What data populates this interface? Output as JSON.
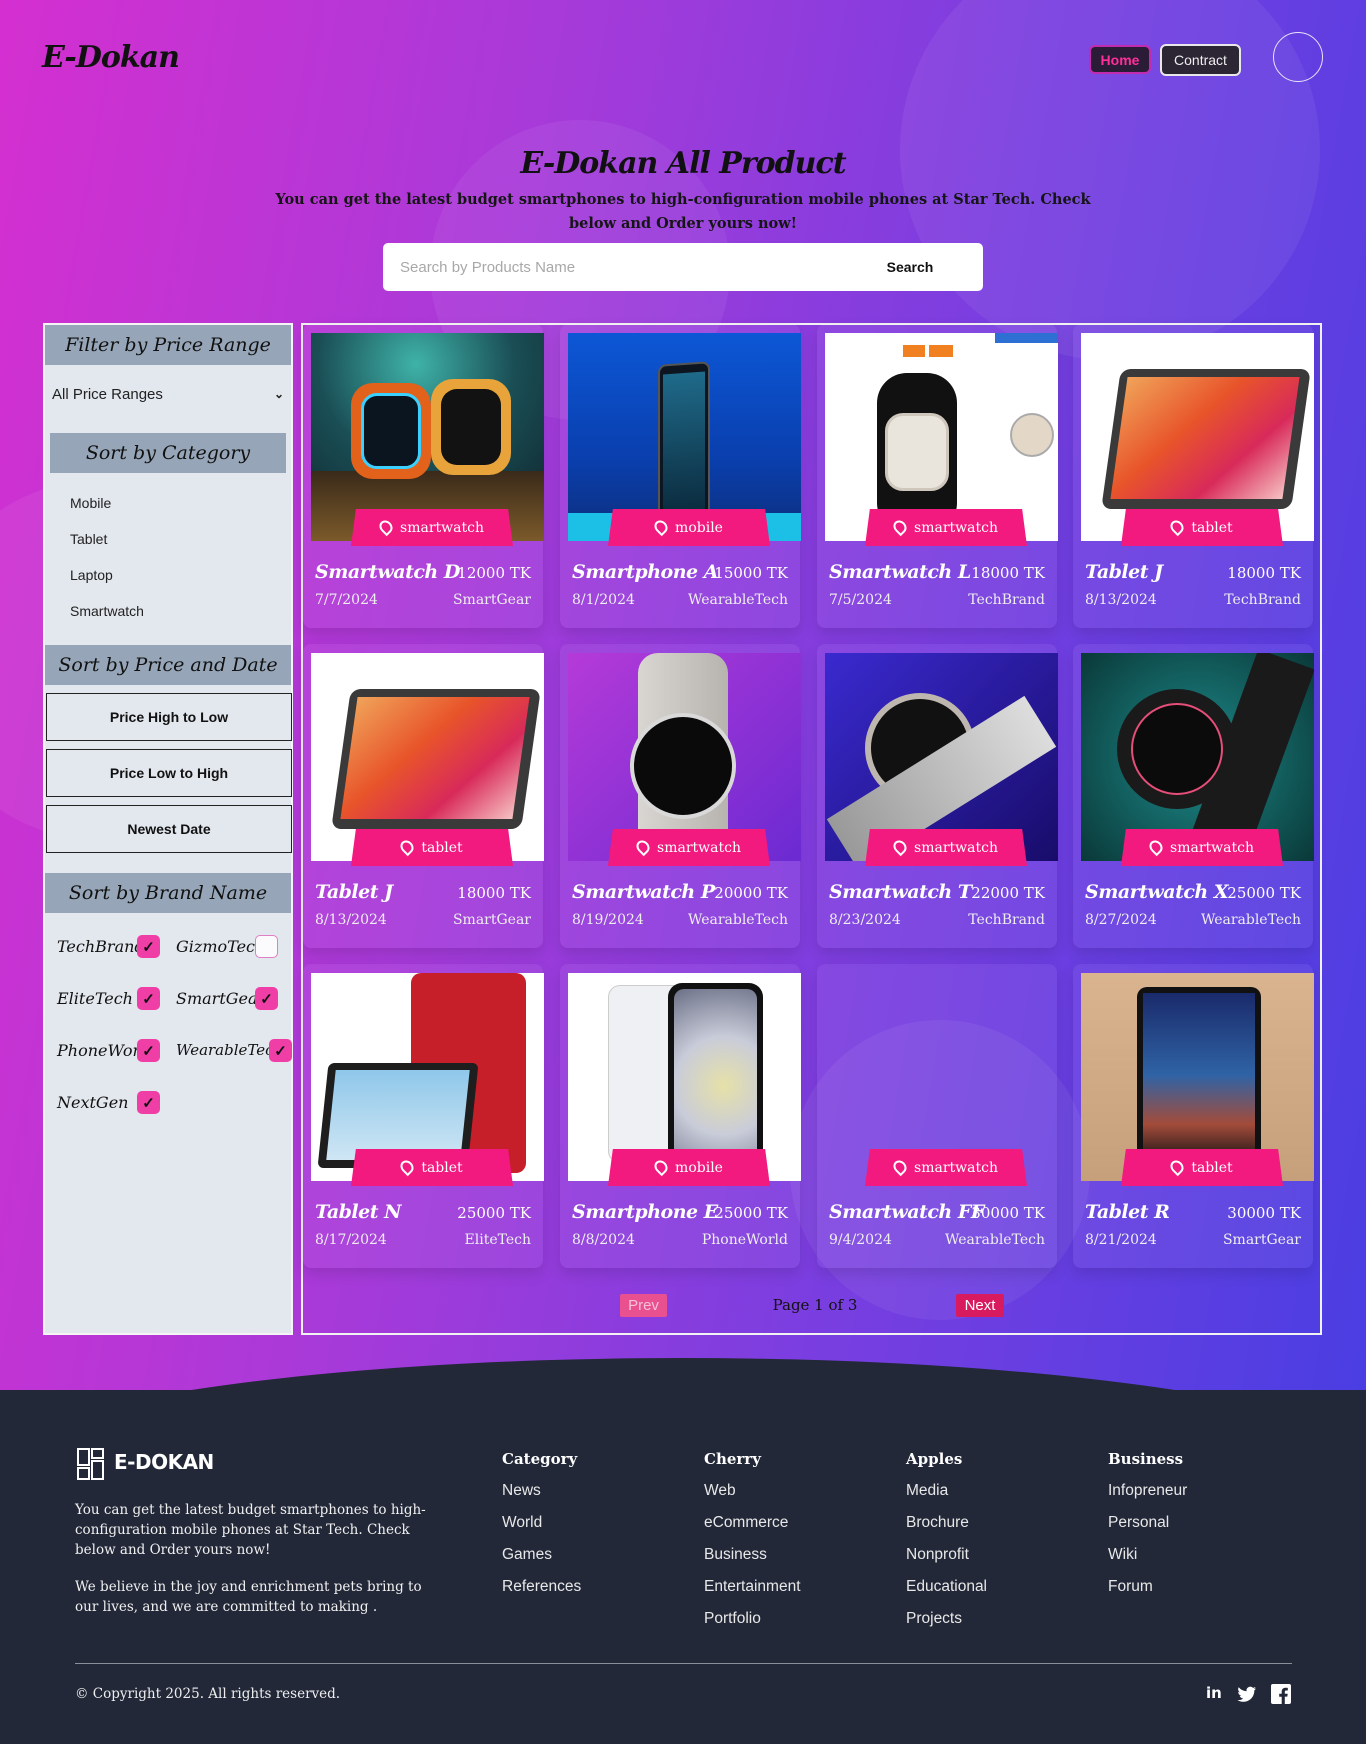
{
  "header": {
    "logo": "E-Dokan",
    "nav": {
      "home": "Home",
      "contract": "Contract"
    }
  },
  "intro": {
    "title": "E-Dokan All Product",
    "subtitle": "You can get the latest budget smartphones to high-configuration mobile phones at Star Tech. Check below and Order yours now!",
    "search_placeholder": "Search by Products Name",
    "search_button": "Search"
  },
  "sidebar": {
    "price_title": "Filter by Price Range",
    "price_selected": "All Price Ranges",
    "category_title": "Sort by Category",
    "categories": [
      "Mobile",
      "Tablet",
      "Laptop",
      "Smartwatch"
    ],
    "sort_title": "Sort by Price and Date",
    "sort_buttons": [
      "Price High to Low",
      "Price Low to High",
      "Newest Date"
    ],
    "brand_title": "Sort by Brand Name",
    "brands": [
      {
        "name": "TechBrand",
        "checked": true
      },
      {
        "name": "GizmoTech",
        "checked": false
      },
      {
        "name": "EliteTech",
        "checked": true
      },
      {
        "name": "SmartGear",
        "checked": true
      },
      {
        "name": "PhoneWorld",
        "checked": true
      },
      {
        "name": "WearableTech",
        "checked": true
      },
      {
        "name": "NextGen",
        "checked": true
      }
    ]
  },
  "products": [
    {
      "name": "Smartwatch D",
      "price": "12000 TK",
      "date": "7/7/2024",
      "brand": "SmartGear",
      "category": "smartwatch"
    },
    {
      "name": "Smartphone A",
      "price": "15000 TK",
      "date": "8/1/2024",
      "brand": "WearableTech",
      "category": "mobile"
    },
    {
      "name": "Smartwatch L",
      "price": "18000 TK",
      "date": "7/5/2024",
      "brand": "TechBrand",
      "category": "smartwatch"
    },
    {
      "name": "Tablet J",
      "price": "18000 TK",
      "date": "8/13/2024",
      "brand": "TechBrand",
      "category": "tablet"
    },
    {
      "name": "Tablet J",
      "price": "18000 TK",
      "date": "8/13/2024",
      "brand": "SmartGear",
      "category": "tablet"
    },
    {
      "name": "Smartwatch P",
      "price": "20000 TK",
      "date": "8/19/2024",
      "brand": "WearableTech",
      "category": "smartwatch"
    },
    {
      "name": "Smartwatch T",
      "price": "22000 TK",
      "date": "8/23/2024",
      "brand": "TechBrand",
      "category": "smartwatch"
    },
    {
      "name": "Smartwatch X",
      "price": "25000 TK",
      "date": "8/27/2024",
      "brand": "WearableTech",
      "category": "smartwatch"
    },
    {
      "name": "Tablet N",
      "price": "25000 TK",
      "date": "8/17/2024",
      "brand": "EliteTech",
      "category": "tablet"
    },
    {
      "name": "Smartphone E",
      "price": "25000 TK",
      "date": "8/8/2024",
      "brand": "PhoneWorld",
      "category": "mobile"
    },
    {
      "name": "Smartwatch FF",
      "price": "30000 TK",
      "date": "9/4/2024",
      "brand": "WearableTech",
      "category": "smartwatch"
    },
    {
      "name": "Tablet R",
      "price": "30000 TK",
      "date": "8/21/2024",
      "brand": "SmartGear",
      "category": "tablet"
    }
  ],
  "pagination": {
    "prev": "Prev",
    "info": "Page 1 of 3",
    "next": "Next"
  },
  "footer": {
    "logo": "E-DOKAN",
    "text1": "You can get the latest budget smartphones to high-configuration mobile phones at Star Tech. Check below and Order yours now!",
    "text2": "We believe in the joy and enrichment pets bring to our lives, and we are committed to making .",
    "columns": [
      {
        "title": "Category",
        "links": [
          "News",
          "World",
          "Games",
          "References"
        ]
      },
      {
        "title": "Cherry",
        "links": [
          "Web",
          "eCommerce",
          "Business",
          "Entertainment",
          "Portfolio"
        ]
      },
      {
        "title": "Apples",
        "links": [
          "Media",
          "Brochure",
          "Nonprofit",
          "Educational",
          "Projects"
        ]
      },
      {
        "title": "Business",
        "links": [
          "Infopreneur",
          "Personal",
          "Wiki",
          "Forum"
        ]
      }
    ],
    "copyright": "© Copyright 2025. All rights reserved.",
    "social": [
      "linkedin-icon",
      "twitter-icon",
      "facebook-icon"
    ]
  },
  "colors": {
    "accent": "#f2197f",
    "footer_bg": "#222838",
    "sidebar_bg": "#e3e7ee",
    "sidebar_header": "#96a6b8"
  }
}
